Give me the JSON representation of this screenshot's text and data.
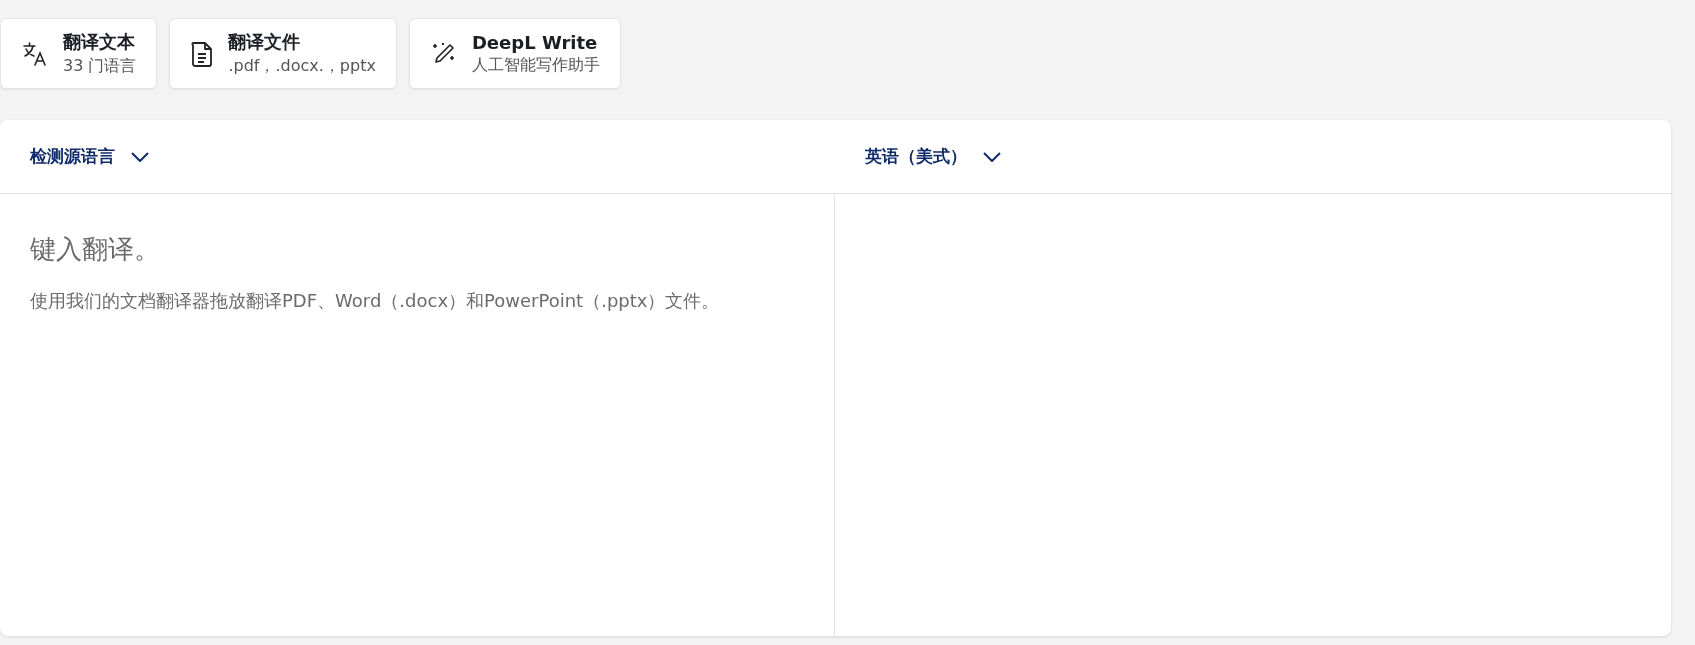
{
  "mode_tabs": [
    {
      "kind": "text",
      "title": "翻译文本",
      "subtitle": "33 门语言"
    },
    {
      "kind": "file",
      "title": "翻译文件",
      "subtitle": ".pdf，.docx.，pptx"
    },
    {
      "kind": "write",
      "title": "DeepL Write",
      "subtitle": "人工智能写作助手"
    }
  ],
  "source": {
    "language": "检测源语言",
    "placeholder": "键入翻译。",
    "hint": "使用我们的文档翻译器拖放翻译PDF、Word（.docx）和PowerPoint（.pptx）文件。"
  },
  "target": {
    "language": "英语（美式）"
  }
}
